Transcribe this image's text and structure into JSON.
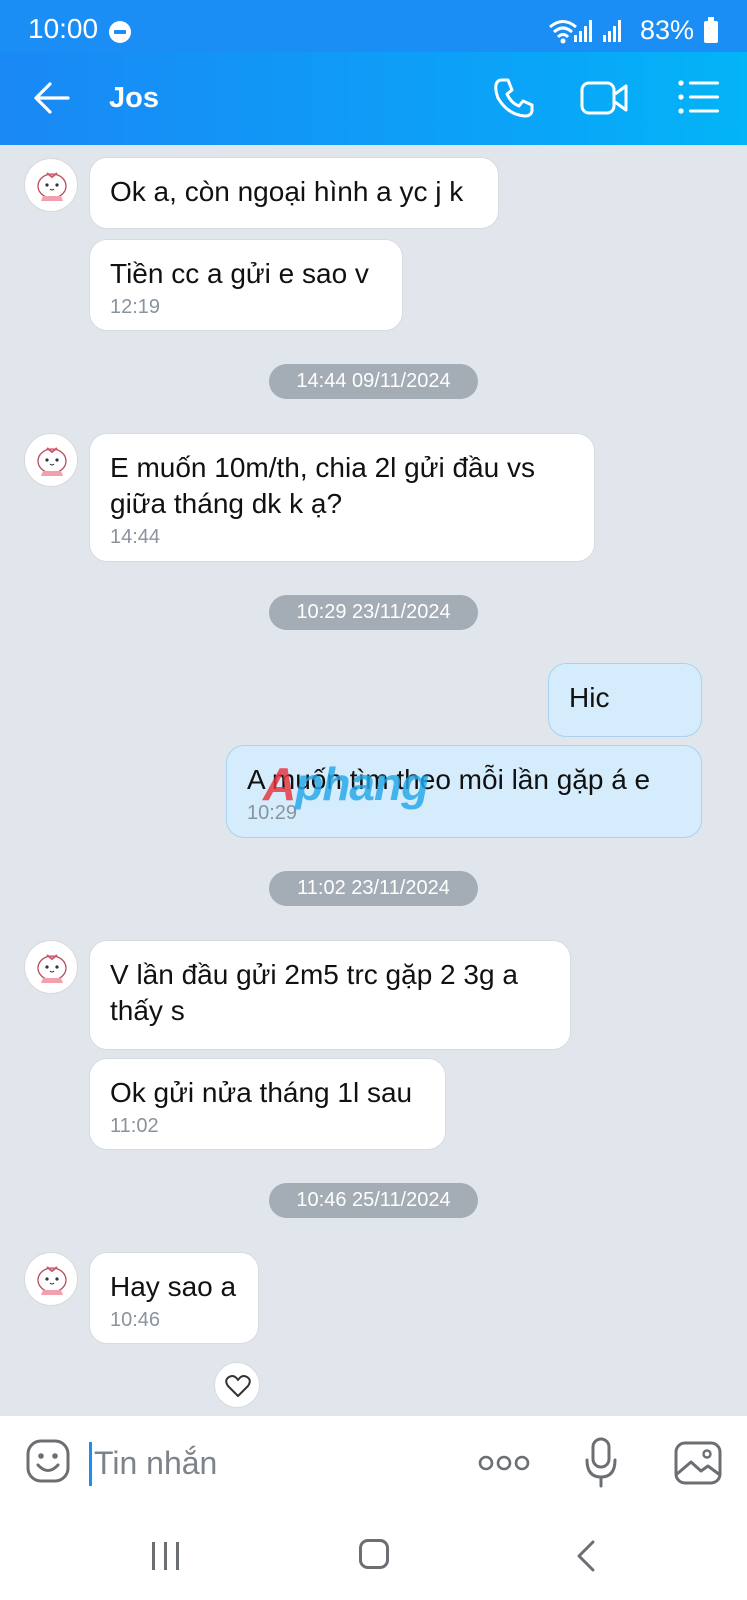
{
  "status_bar": {
    "time": "10:00",
    "battery": "83%"
  },
  "header": {
    "contact_name": "Jos"
  },
  "messages": [
    {
      "text": "Ok a, còn ngoại hình a yc j k"
    },
    {
      "text": "Tiền cc a gửi e sao v",
      "time": "12:19"
    },
    {
      "date": "14:44 09/11/2024"
    },
    {
      "text": "E muốn 10m/th, chia 2l gửi đầu vs giữa tháng dk k ạ?",
      "time": "14:44"
    },
    {
      "date": "10:29 23/11/2024"
    },
    {
      "text": "Hic"
    },
    {
      "text": "A muốn tìm theo mỗi lần gặp á e",
      "time": "10:29"
    },
    {
      "date": "11:02 23/11/2024"
    },
    {
      "text": "V lần đầu gửi 2m5 trc gặp 2 3g a thấy s"
    },
    {
      "text": "Ok gửi nửa tháng 1l sau",
      "time": "11:02"
    },
    {
      "date": "10:46 25/11/2024"
    },
    {
      "text": "Hay sao a",
      "time": "10:46"
    }
  ],
  "watermark": {
    "part1": "A",
    "part2": "phang"
  },
  "input": {
    "placeholder": "Tin nhắn"
  },
  "icons": {
    "back": "arrow-left-icon",
    "call": "phone-icon",
    "video": "video-camera-icon",
    "menu": "list-icon",
    "emoji": "emoji-icon",
    "more": "more-dots-icon",
    "mic": "microphone-icon",
    "gallery": "image-icon",
    "reaction": "heart-icon"
  },
  "colors": {
    "header": "#1a8ef5",
    "incoming_bubble": "#ffffff",
    "outgoing_bubble": "#d5ecfc",
    "background": "#e1e6ec"
  }
}
